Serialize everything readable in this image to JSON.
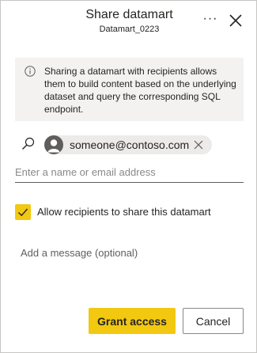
{
  "dialog": {
    "title": "Share datamart",
    "subtitle": "Datamart_0223",
    "more_icon": "more-horizontal-icon",
    "close_icon": "close-icon"
  },
  "info": {
    "icon": "info-icon",
    "text": "Sharing a datamart with recipients allows them to build content based on the underlying dataset and query the corresponding SQL endpoint."
  },
  "recipients": {
    "search_icon": "search-icon",
    "chips": [
      {
        "label": "someone@contoso.com",
        "avatar_icon": "person-icon",
        "remove_icon": "dismiss-icon"
      }
    ],
    "input_placeholder": "Enter a name or email address",
    "input_value": ""
  },
  "options": {
    "allow_reshare": {
      "label": "Allow recipients to share this datamart",
      "checked": true
    }
  },
  "message": {
    "placeholder": "Add a message (optional)",
    "value": ""
  },
  "actions": {
    "grant_label": "Grant access",
    "cancel_label": "Cancel"
  },
  "colors": {
    "accent": "#f2c811",
    "info_background": "#f3f2f1",
    "chip_background": "#edebe9",
    "text": "#252423"
  }
}
